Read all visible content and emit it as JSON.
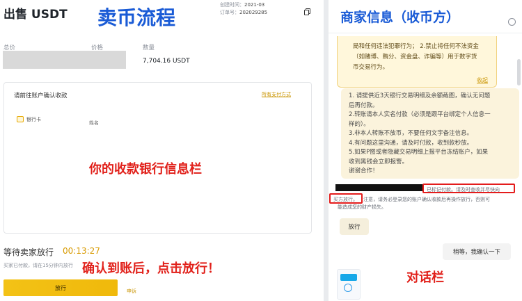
{
  "page": {
    "title": "出售 USDT",
    "created_label": "创建时间：",
    "created_value": "2021-03",
    "order_label": "订单号：",
    "order_value": "202029285",
    "copy_icon": "copy-icon"
  },
  "overlays": {
    "main_title": "卖币流程",
    "merchant_title": "商家信息（收币方）",
    "bank_info_note": "你的收款银行信息栏",
    "release_note": "确认到账后，点击放行！",
    "chat_note": "对话栏"
  },
  "summary": {
    "total_label": "总价",
    "price_label": "价格",
    "qty_label": "数量",
    "qty_value": "7,704.16 USDT"
  },
  "payment": {
    "prompt": "请前往账户确认收款",
    "all_methods": "所有支付方式",
    "method_label": "银行卡",
    "name_label": "姓名"
  },
  "release": {
    "waiting_label": "等待卖家放行",
    "timer": "00:13:27",
    "sub_note": "买家已付款，请在15分钟内放行",
    "button_label": "放行",
    "appeal_label": "申诉"
  },
  "chat": {
    "phone_icon": "phone-icon",
    "notice_line1": "局和任何违法犯罪行为； 2.禁止将任何不法资金",
    "notice_line2": "（如赌博、贿分、资金盘、诈骗等）用于数字货",
    "notice_line3": "币交易行为。",
    "collapse_label": "收起",
    "rules": [
      "1. 请提供近3天银行交易明细及余额截图，确认无问题",
      "后再付款。",
      "2.转账请本人实名付款（必须是跟平台绑定个人信息一",
      "样的）。",
      "3.非本人转账不放币，不要任何文字备注信息。",
      "4.有问题这里沟通，请及时付款，收到款秒放。",
      "5.如果P图或者隐藏交易明细上报平台冻结账户，如果",
      "收到黑钱会立即报警。",
      "谢谢合作！"
    ],
    "system_msg_a": "已标记付款。请及时查收并尽快向",
    "system_msg_b": "买方放行。",
    "system_msg_c": "注意，请务必登录您的账户确认收款后再操作放行，否则可",
    "system_msg_d": "能造成您的财产损失。",
    "release_bubble": "放行",
    "reply_bubble": "稍等，我确认一下"
  },
  "colors": {
    "accent_blue": "#1a5bd6",
    "note_red": "#e1201a",
    "brand_yellow": "#f0b90b"
  }
}
